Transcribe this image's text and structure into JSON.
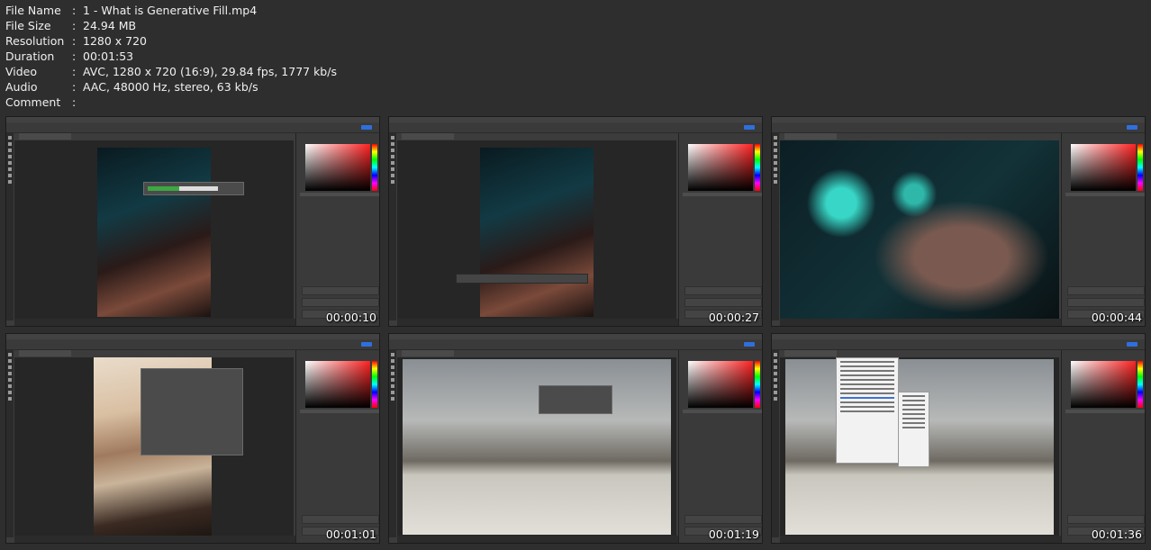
{
  "file_info": [
    {
      "key": "File Name",
      "value": "1 - What is Generative Fill.mp4"
    },
    {
      "key": "File Size",
      "value": "24.94 MB"
    },
    {
      "key": "Resolution",
      "value": "1280 x 720"
    },
    {
      "key": "Duration",
      "value": "00:01:53"
    },
    {
      "key": "Video",
      "value": "AVC, 1280 x 720 (16:9), 29.84 fps, 1777 kb/s"
    },
    {
      "key": "Audio",
      "value": "AAC, 48000 Hz, stereo, 63 kb/s"
    },
    {
      "key": "Comment",
      "value": ""
    }
  ],
  "separator": ":",
  "thumbnails": [
    {
      "timestamp": "00:00:10"
    },
    {
      "timestamp": "00:00:27"
    },
    {
      "timestamp": "00:00:44"
    },
    {
      "timestamp": "00:01:01"
    },
    {
      "timestamp": "00:01:19"
    },
    {
      "timestamp": "00:01:36"
    }
  ],
  "colors": {
    "background": "#2e2e2e",
    "photoshop_ui": "#3c3c3c",
    "share_button": "#2f6fdd",
    "progress_green": "#3da743"
  }
}
